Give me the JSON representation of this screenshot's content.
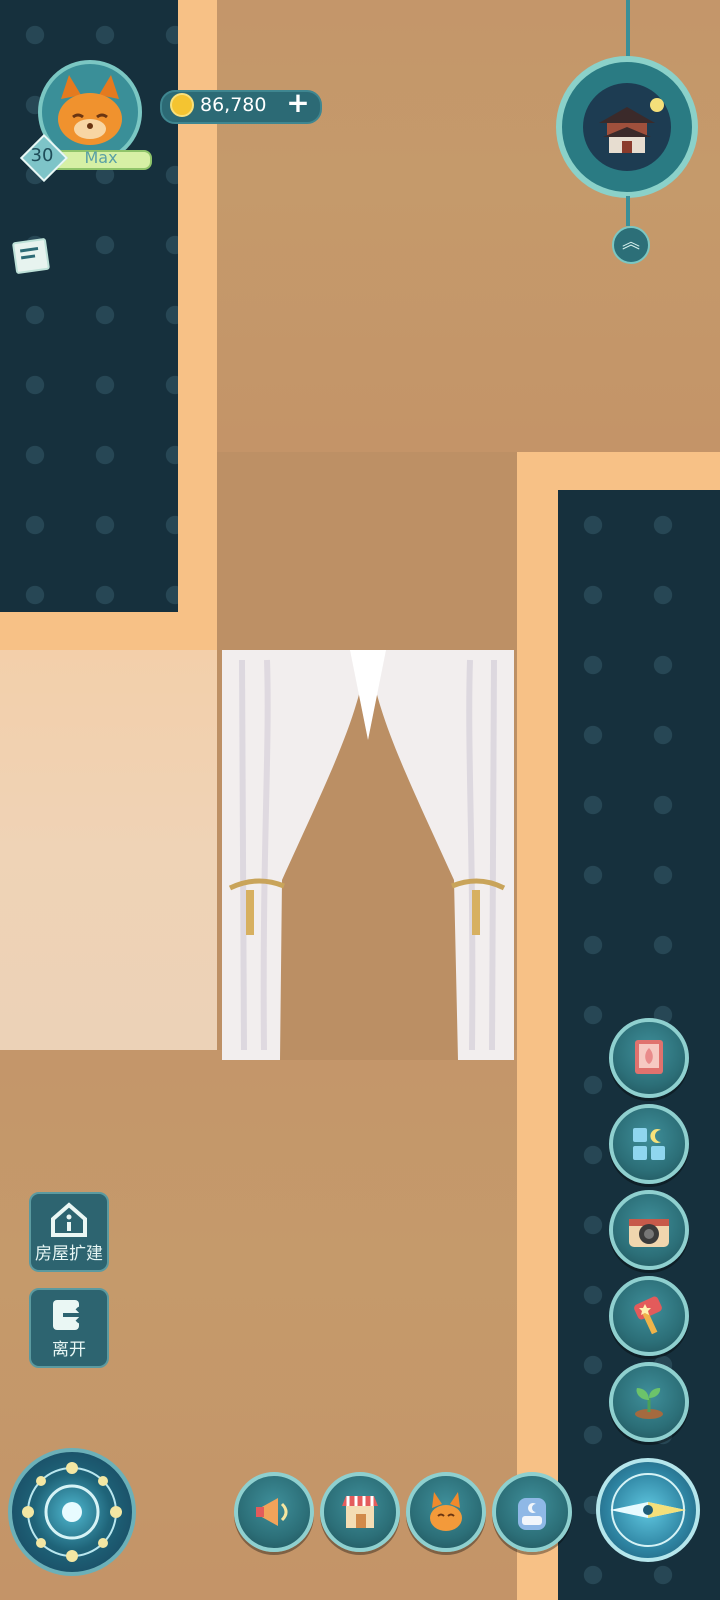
{
  "player": {
    "level": "30",
    "level_status": "Max",
    "avatar_icon": "orange-fox-avatar"
  },
  "currency": {
    "coins": "86,780",
    "add_label": "+"
  },
  "left_buttons": [
    {
      "id": "house-expand",
      "label": "房屋扩建",
      "icon": "house-info-icon"
    },
    {
      "id": "leave",
      "label": "离开",
      "icon": "exit-icon"
    }
  ],
  "right_buttons": [
    {
      "id": "guide-book",
      "icon": "book-icon"
    },
    {
      "id": "furniture",
      "icon": "blocks-moon-icon"
    },
    {
      "id": "camera",
      "icon": "camera-icon"
    },
    {
      "id": "event",
      "icon": "hammer-icon"
    },
    {
      "id": "plant",
      "icon": "sprout-icon"
    }
  ],
  "bottom_buttons": [
    {
      "id": "announcement",
      "icon": "megaphone-icon"
    },
    {
      "id": "shop",
      "icon": "shop-icon"
    },
    {
      "id": "pets",
      "icon": "fox-icon"
    },
    {
      "id": "backpack",
      "icon": "backpack-icon"
    }
  ],
  "colors": {
    "wall_dark": "#16303d",
    "floor": "#c4966a",
    "trim": "#f7c186",
    "hud_teal": "#2c6f78"
  }
}
